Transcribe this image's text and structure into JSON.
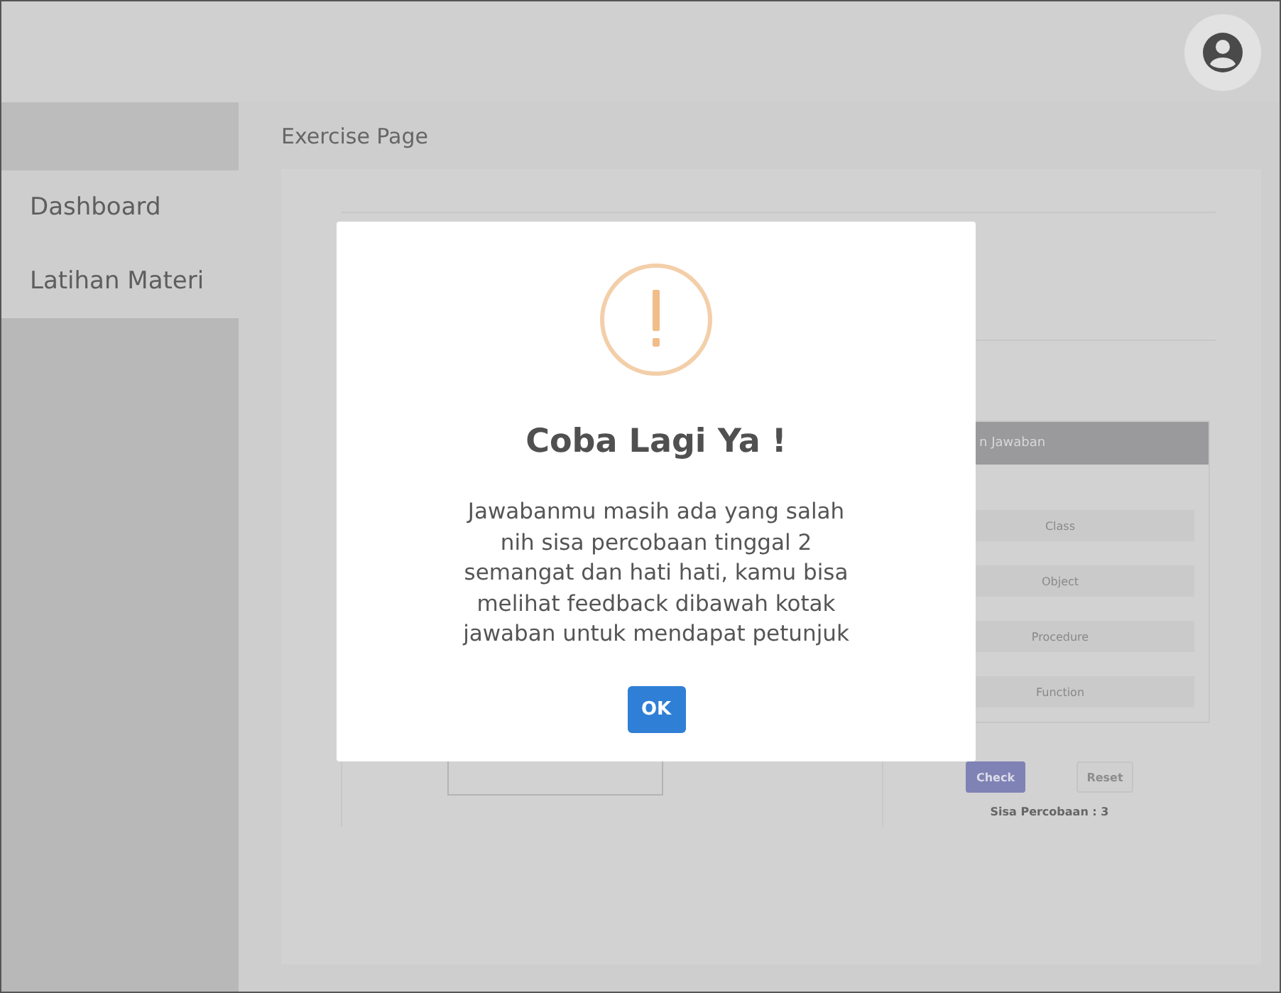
{
  "sidebar": {
    "items": [
      {
        "label": "Dashboard"
      },
      {
        "label": "Latihan Materi"
      }
    ]
  },
  "page": {
    "title": "Exercise Page"
  },
  "answer_panel": {
    "header": "n Jawaban",
    "options": [
      "Class",
      "Object",
      "Procedure",
      "Function"
    ],
    "buttons": [
      {
        "label": "Check",
        "kind": "primary"
      },
      {
        "label": "Reset",
        "kind": "secondary"
      }
    ],
    "attempts": "Sisa Percobaan : 3"
  },
  "dialog": {
    "title": "Coba Lagi Ya !",
    "message": "Jawabanmu masih ada yang salah\nnih sisa percobaan tinggal 2\nsemangat dan hati hati, kamu bisa\nmelihat feedback dibawah kotak\njawaban untuk mendapat petunjuk",
    "button": "OK"
  }
}
